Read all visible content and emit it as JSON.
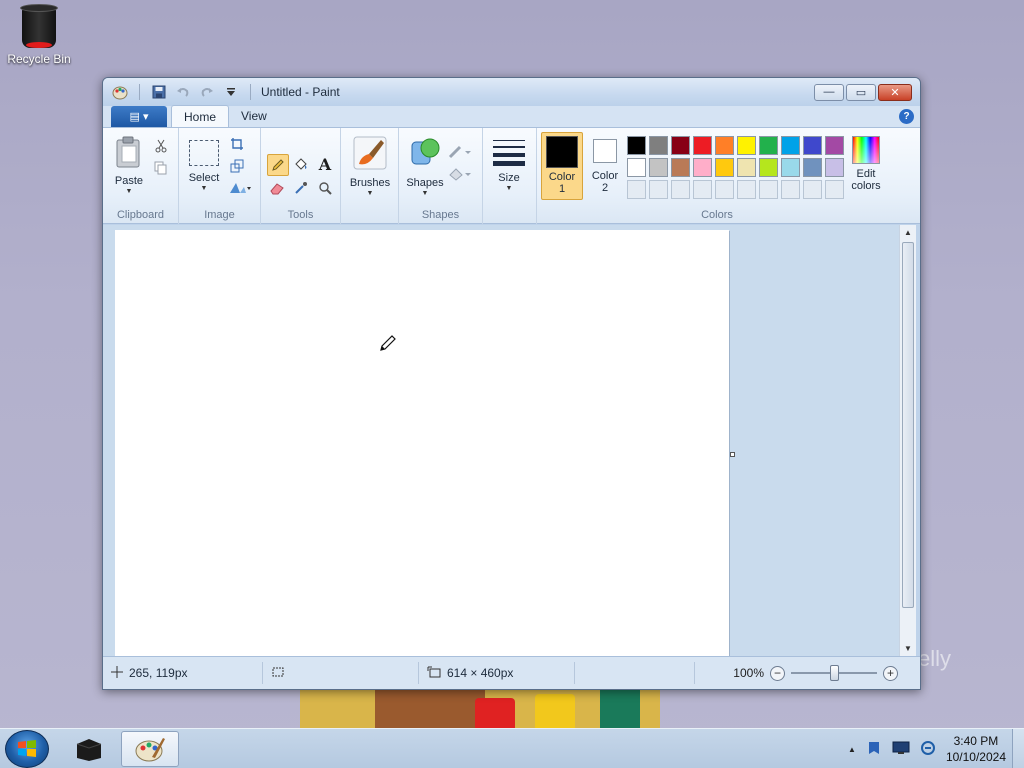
{
  "desktop": {
    "recycle_bin_label": "Recycle Bin",
    "watermark_text": "elly"
  },
  "window": {
    "title": "Untitled - Paint",
    "quick_access": [
      "paint-menu-icon",
      "save-icon",
      "undo-icon",
      "redo-icon",
      "customize-dropdown-icon"
    ],
    "controls": {
      "minimize": "—",
      "maximize": "▭",
      "close": "✕"
    }
  },
  "tabs": {
    "app_menu": "▤ ▾",
    "home": "Home",
    "view": "View",
    "help": "?"
  },
  "ribbon": {
    "clipboard": {
      "label": "Clipboard",
      "paste": "Paste"
    },
    "image": {
      "label": "Image",
      "select": "Select"
    },
    "tools": {
      "label": "Tools",
      "text_tool": "A"
    },
    "brushes": {
      "label": "Brushes"
    },
    "shapes": {
      "label": "Shapes",
      "shapes_btn": "Shapes"
    },
    "size": {
      "label": "Size"
    },
    "colors": {
      "label": "Colors",
      "color1_line1": "Color",
      "color1_line2": "1",
      "color2_line1": "Color",
      "color2_line2": "2",
      "color1_value": "#000000",
      "color2_value": "#ffffff",
      "edit_line1": "Edit",
      "edit_line2": "colors",
      "palette_row1": [
        "#000000",
        "#7f7f7f",
        "#880015",
        "#ed1c24",
        "#ff7f27",
        "#fff200",
        "#22b14c",
        "#00a2e8",
        "#3f48cc",
        "#a349a4"
      ],
      "palette_row2": [
        "#ffffff",
        "#c3c3c3",
        "#b97a57",
        "#ffaec9",
        "#ffc90e",
        "#efe4b0",
        "#b5e61d",
        "#99d9ea",
        "#7092be",
        "#c8bfe7"
      ]
    }
  },
  "status": {
    "cursor_pos": "265, 119px",
    "canvas_size": "614 × 460px",
    "zoom": "100%",
    "zoom_level": 1.0
  },
  "taskbar": {
    "time": "3:40 PM",
    "date": "10/10/2024",
    "tray_arrow": "▲"
  }
}
